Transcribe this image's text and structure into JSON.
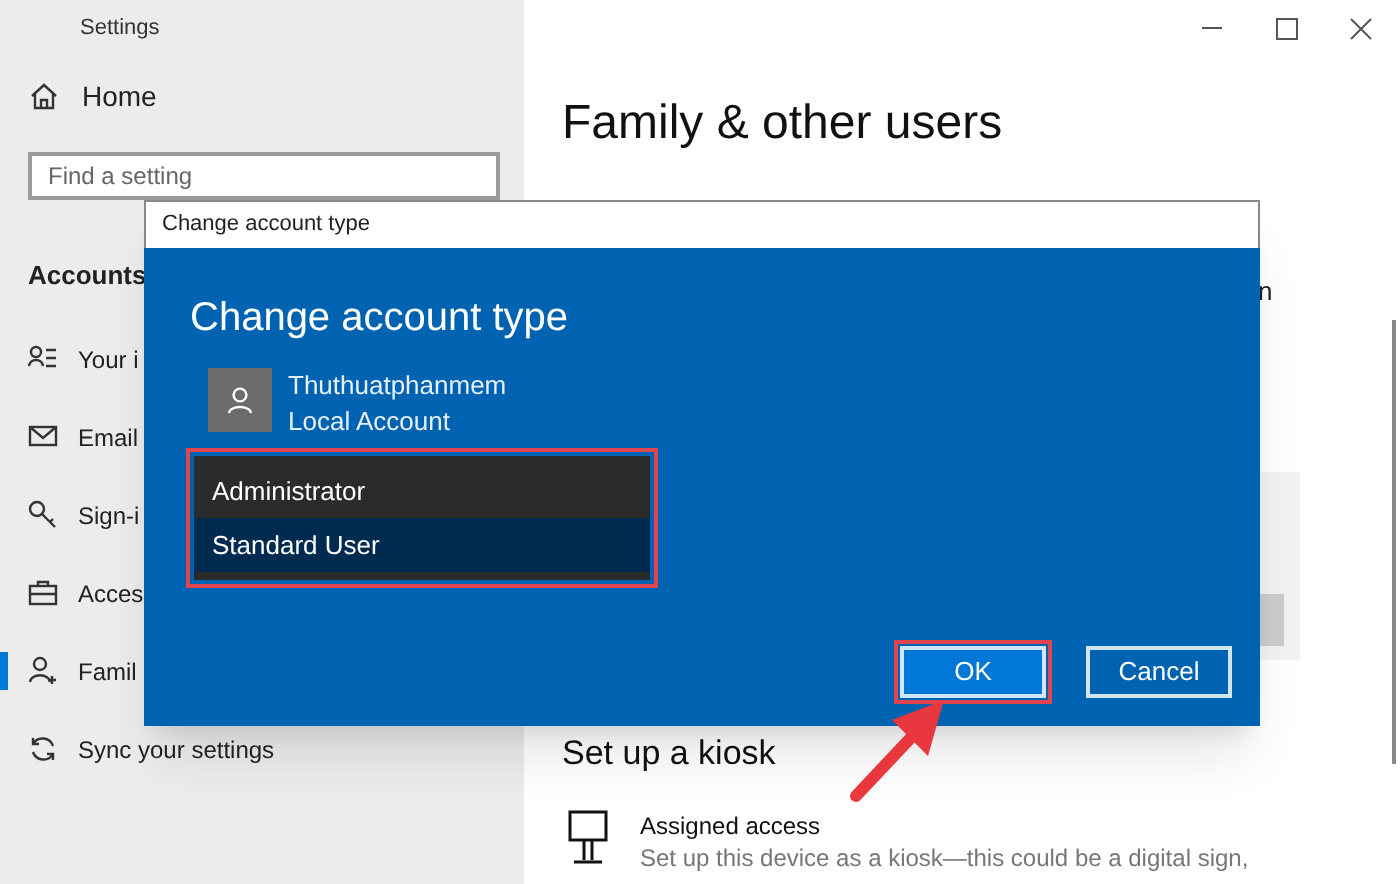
{
  "window": {
    "title": "Settings"
  },
  "sidebar": {
    "home": "Home",
    "search": {
      "placeholder": "Find a setting"
    },
    "section": "Accounts",
    "items": [
      {
        "label": "Your i",
        "selected": false
      },
      {
        "label": "Email",
        "selected": false
      },
      {
        "label": "Sign-i",
        "selected": false
      },
      {
        "label": "Acces",
        "selected": false
      },
      {
        "label": "Famil",
        "selected": true
      },
      {
        "label": "Sync your settings",
        "selected": false
      }
    ]
  },
  "content": {
    "title": "Family & other users",
    "fragment": "n",
    "kiosk": {
      "heading": "Set up a kiosk",
      "item_title": "Assigned access",
      "item_desc": "Set up this device as a kiosk—this could be a digital sign,"
    }
  },
  "dialog": {
    "title": "Change account type",
    "heading": "Change account type",
    "account": {
      "name": "Thuthuatphanmem",
      "type": "Local Account"
    },
    "highlighted": true,
    "options": [
      {
        "label": "Administrator",
        "selected": false
      },
      {
        "label": "Standard User",
        "selected": true
      }
    ],
    "buttons": [
      {
        "label": "OK",
        "kind": "primary",
        "highlighted": true
      },
      {
        "label": "Cancel",
        "kind": "secondary",
        "highlighted": false
      }
    ]
  }
}
